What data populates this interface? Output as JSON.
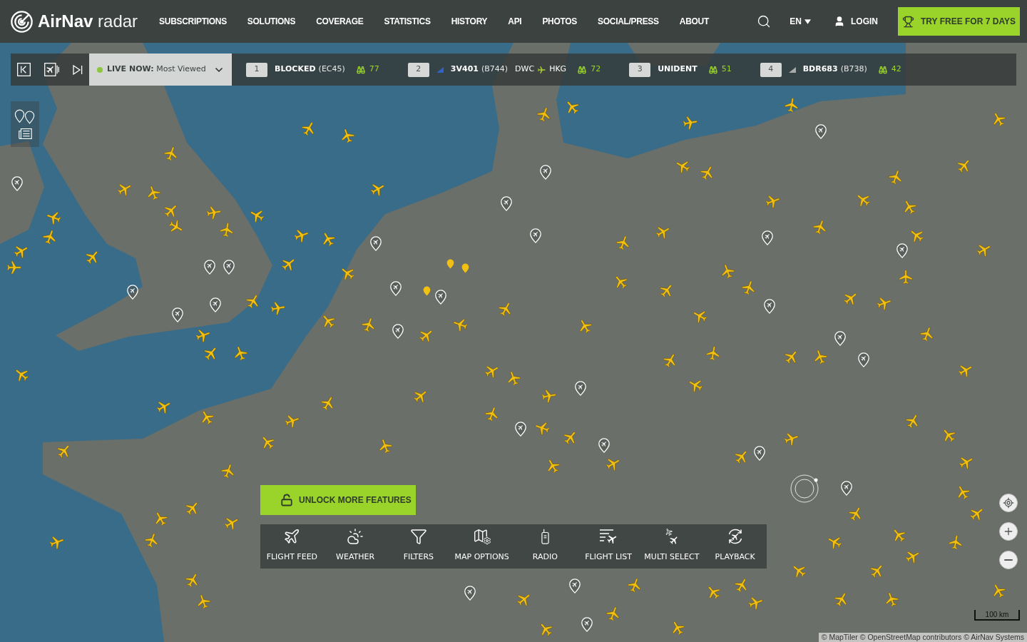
{
  "header": {
    "logo": {
      "brand": "AirNav",
      "product": "radar"
    },
    "nav": [
      "SUBSCRIPTIONS",
      "SOLUTIONS",
      "COVERAGE",
      "STATISTICS",
      "HISTORY",
      "API",
      "PHOTOS",
      "SOCIAL/PRESS",
      "ABOUT"
    ],
    "language": "EN",
    "login": "LOGIN",
    "cta": "TRY FREE FOR 7 DAYS"
  },
  "live_bar": {
    "label": "LIVE NOW:",
    "mode": "Most Viewed",
    "flights": [
      {
        "rank": "1",
        "callsign": "BLOCKED",
        "aircraft": "(EC45)",
        "viewers": "77"
      },
      {
        "rank": "2",
        "color": "#2f63c8",
        "callsign": "3V401",
        "aircraft": "(B744)",
        "origin": "DWC",
        "destination": "HKG",
        "viewers": "72"
      },
      {
        "rank": "3",
        "callsign": "UNIDENT",
        "viewers": "51"
      },
      {
        "rank": "4",
        "color": "#a9acaa",
        "callsign": "BDR683",
        "aircraft": "(B738)",
        "viewers": "42"
      }
    ]
  },
  "unlock_button": "UNLOCK MORE FEATURES",
  "toolbar": [
    {
      "kind": "flight-feed",
      "label": "FLIGHT FEED"
    },
    {
      "kind": "weather",
      "label": "WEATHER"
    },
    {
      "kind": "filters",
      "label": "FILTERS"
    },
    {
      "kind": "map-options",
      "label": "MAP OPTIONS"
    },
    {
      "kind": "radio",
      "label": "RADIO"
    },
    {
      "kind": "flight-list",
      "label": "FLIGHT LIST"
    },
    {
      "kind": "multi-select",
      "label": "MULTI SELECT"
    },
    {
      "kind": "playback",
      "label": "PLAYBACK"
    }
  ],
  "map": {
    "scale": "100 km",
    "attribution": "© MapTiler © OpenStreetMap contributors © AirNav Systems"
  }
}
